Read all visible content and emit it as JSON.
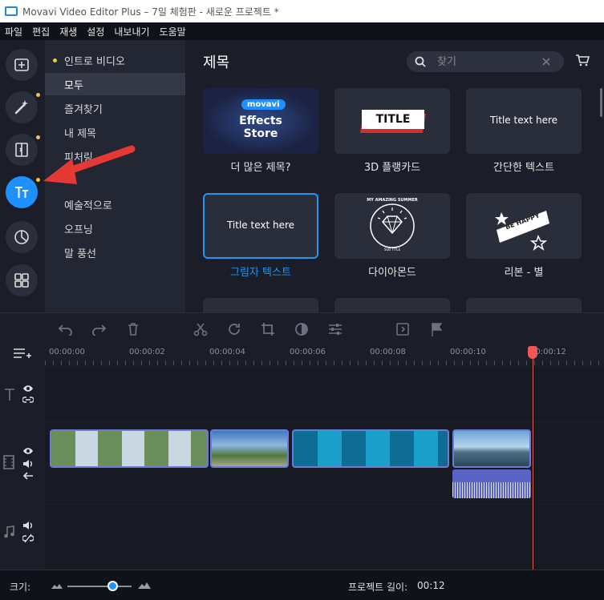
{
  "window": {
    "title": "Movavi Video Editor Plus – 7일 체험판 - 새로운 프로젝트 *"
  },
  "menu": [
    "파일",
    "편집",
    "재생",
    "설정",
    "내보내기",
    "도움말"
  ],
  "rail": [
    {
      "name": "import",
      "icon": "add-media-icon",
      "dot": false,
      "active": false
    },
    {
      "name": "effects",
      "icon": "magic-wand-icon",
      "dot": true,
      "active": false
    },
    {
      "name": "transitions",
      "icon": "transition-icon",
      "dot": true,
      "active": false
    },
    {
      "name": "titles",
      "icon": "titles-icon",
      "dot": true,
      "active": true
    },
    {
      "name": "stickers",
      "icon": "sticker-icon",
      "dot": false,
      "active": false
    },
    {
      "name": "more",
      "icon": "grid-icon",
      "dot": false,
      "active": false
    }
  ],
  "categories": [
    {
      "label": "인트로 비디오",
      "dot": true,
      "selected": false
    },
    {
      "label": "모두",
      "dot": false,
      "selected": true
    },
    {
      "label": "즐겨찾기",
      "dot": false,
      "selected": false
    },
    {
      "label": "내 제목",
      "dot": false,
      "selected": false
    },
    {
      "label": "피처링",
      "dot": false,
      "selected": false
    },
    {
      "label": "",
      "dot": false,
      "selected": false
    },
    {
      "label": "예술적으로",
      "dot": false,
      "selected": false
    },
    {
      "label": "오프닝",
      "dot": false,
      "selected": false
    },
    {
      "label": "말 풍선",
      "dot": false,
      "selected": false
    }
  ],
  "content": {
    "heading": "제목",
    "search_placeholder": "찾기",
    "tiles": [
      {
        "label": "더 많은 제목?",
        "kind": "store",
        "badge": "movavi",
        "line1": "Effects",
        "line2": "Store"
      },
      {
        "label": "3D 플랭카드",
        "kind": "title3d",
        "text": "TITLE"
      },
      {
        "label": "간단한 텍스트",
        "kind": "plain",
        "text": "Title text here"
      },
      {
        "label": "그림자 텍스트",
        "kind": "plain",
        "text": "Title text here",
        "selected": true
      },
      {
        "label": "다이아몬드",
        "kind": "diamond",
        "text_top": "MY AMAZING SUMMER",
        "text_bottom": "SUB TITLE"
      },
      {
        "label": "리본 - 별",
        "kind": "ribbon",
        "text": "BE HAPPY"
      }
    ]
  },
  "timeline": {
    "ticks": [
      "00:00:00",
      "00:00:02",
      "00:00:04",
      "00:00:06",
      "00:00:08",
      "00:00:10",
      "00:00:12"
    ]
  },
  "status": {
    "size_label": "크기:",
    "duration_label": "프로젝트 길이:",
    "duration_value": "00:12",
    "zoom_level": 0.62
  },
  "colors": {
    "accent": "#1e90ff",
    "dot": "#f3c63f",
    "playhead": "#f05656",
    "arrow": "#e53935"
  }
}
